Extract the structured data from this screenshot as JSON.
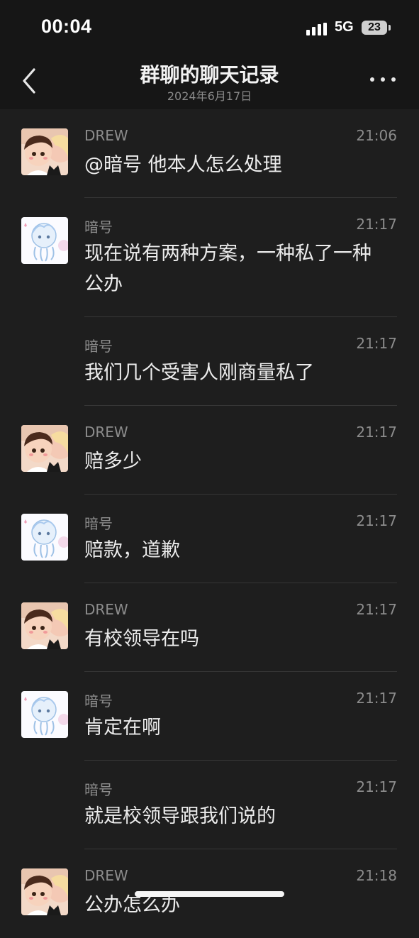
{
  "status": {
    "time": "00:04",
    "network": "5G",
    "battery": "23"
  },
  "header": {
    "title": "群聊的聊天记录",
    "subtitle": "2024年6月17日"
  },
  "messages": [
    {
      "sender": "DREW",
      "time": "21:06",
      "text": "@暗号 他本人怎么处理",
      "avatar": "drew"
    },
    {
      "sender": "暗号",
      "time": "21:17",
      "text": "现在说有两种方案，一种私了一种公办",
      "avatar": "anhao"
    },
    {
      "sender": "暗号",
      "time": "21:17",
      "text": "我们几个受害人刚商量私了",
      "avatar": ""
    },
    {
      "sender": "DREW",
      "time": "21:17",
      "text": "赔多少",
      "avatar": "drew"
    },
    {
      "sender": "暗号",
      "time": "21:17",
      "text": "赔款，道歉",
      "avatar": "anhao"
    },
    {
      "sender": "DREW",
      "time": "21:17",
      "text": "有校领导在吗",
      "avatar": "drew"
    },
    {
      "sender": "暗号",
      "time": "21:17",
      "text": "肯定在啊",
      "avatar": "anhao"
    },
    {
      "sender": "暗号",
      "time": "21:17",
      "text": "就是校领导跟我们说的",
      "avatar": ""
    },
    {
      "sender": "DREW",
      "time": "21:18",
      "text": "公办怎么办",
      "avatar": "drew"
    }
  ]
}
